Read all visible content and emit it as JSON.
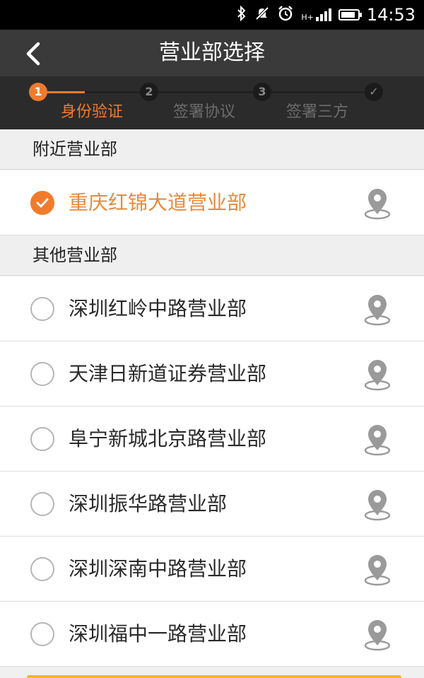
{
  "status_bar": {
    "time": "14:53",
    "network": "H+",
    "battery_level": 0.85
  },
  "nav": {
    "title": "营业部选择",
    "back_icon": "chevron-left-icon"
  },
  "steps": [
    {
      "number": "1",
      "label": "身份验证",
      "state": "active"
    },
    {
      "number": "2",
      "label": "签署协议",
      "state": "pending"
    },
    {
      "number": "3",
      "label": "签署三方",
      "state": "pending"
    },
    {
      "number": "✓",
      "label": "",
      "state": "pending"
    }
  ],
  "nearby": {
    "header": "附近营业部",
    "items": [
      {
        "name": "重庆红锦大道营业部",
        "selected": true
      }
    ]
  },
  "other": {
    "header": "其他营业部",
    "items": [
      {
        "name": "深圳红岭中路营业部",
        "selected": false
      },
      {
        "name": "天津日新道证券营业部",
        "selected": false
      },
      {
        "name": "阜宁新城北京路营业部",
        "selected": false
      },
      {
        "name": "深圳振华路营业部",
        "selected": false
      },
      {
        "name": "深圳深南中路营业部",
        "selected": false
      },
      {
        "name": "深圳福中一路营业部",
        "selected": false
      }
    ]
  },
  "colors": {
    "accent": "#f07b2d",
    "nav_bg": "#3a3a3a",
    "steps_bg": "#2b2b2b"
  }
}
